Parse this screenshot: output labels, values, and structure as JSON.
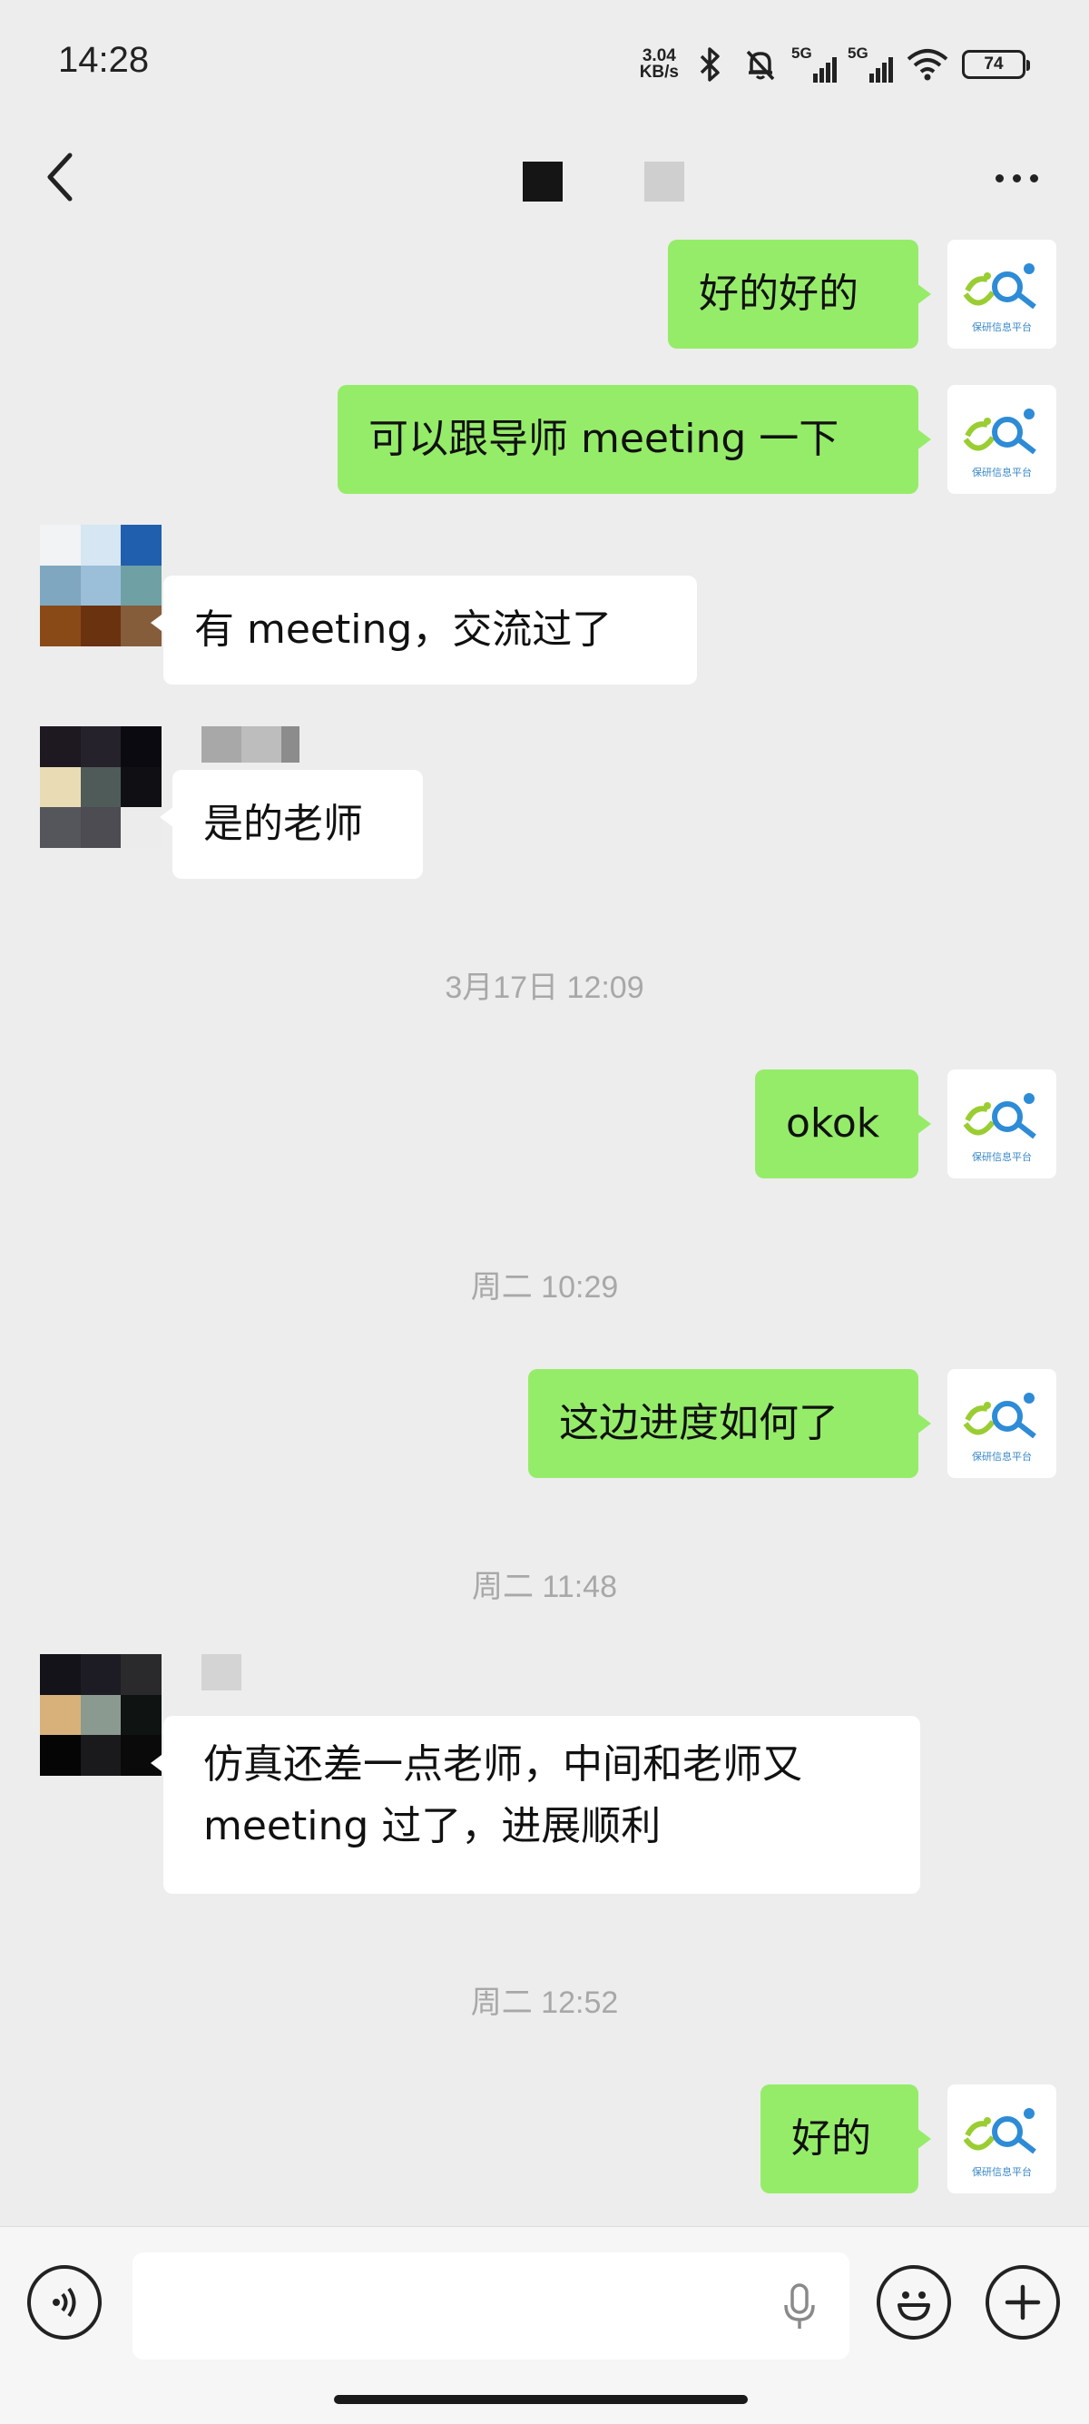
{
  "status_bar": {
    "time": "14:28",
    "net_speed_value": "3.04",
    "net_speed_unit": "KB/s",
    "sim1_label": "5G",
    "sim2_label": "5G",
    "battery": "74",
    "icons": [
      "bluetooth-icon",
      "mute-bell-icon",
      "signal-icon",
      "wifi-icon",
      "battery-icon"
    ]
  },
  "title_bar": {
    "icons": [
      "back-arrow-icon",
      "more-icon"
    ]
  },
  "messages": [
    {
      "dir": "out",
      "text": "好的好的"
    },
    {
      "dir": "out",
      "text": "可以跟导师 meeting 一下"
    },
    {
      "dir": "in",
      "text": "有 meeting，交流过了"
    },
    {
      "dir": "in",
      "text": "是的老师"
    },
    {
      "type": "time",
      "text": "3月17日 12:09"
    },
    {
      "dir": "out",
      "text": "okok"
    },
    {
      "type": "time",
      "text": "周二 10:29"
    },
    {
      "dir": "out",
      "text": "这边进度如何了"
    },
    {
      "type": "time",
      "text": "周二 11:48"
    },
    {
      "dir": "in",
      "line1": "仿真还差一点老师，中间和老师又",
      "line2": "meeting 过了，进展顺利"
    },
    {
      "type": "time",
      "text": "周二 12:52"
    },
    {
      "dir": "out",
      "text": "好的"
    }
  ],
  "my_avatar": {
    "logo_text": "保研信息平台"
  },
  "input_bar": {
    "value": "",
    "icons": [
      "voice-icon",
      "microphone-icon",
      "emoji-icon",
      "plus-icon"
    ]
  },
  "colors": {
    "background": "#ededed",
    "outgoing_bubble": "#95ec69",
    "incoming_bubble": "#ffffff",
    "timestamp": "#a8a8a8"
  }
}
